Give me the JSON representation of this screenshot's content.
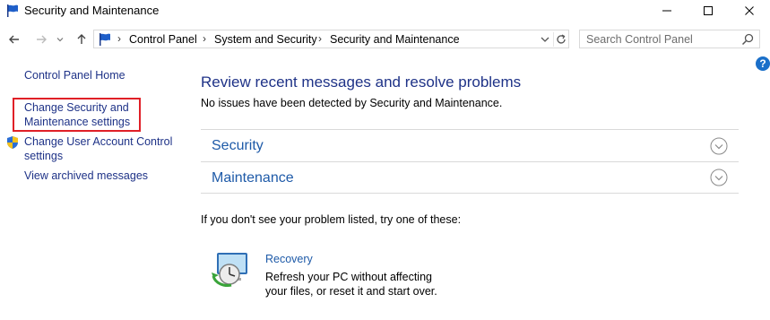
{
  "window": {
    "title": "Security and Maintenance"
  },
  "address": {
    "crumbs": [
      "Control Panel",
      "System and Security",
      "Security and Maintenance"
    ],
    "sep": "›"
  },
  "search": {
    "placeholder": "Search Control Panel"
  },
  "help": {
    "label": "?"
  },
  "sidebar": {
    "items": [
      {
        "label": "Control Panel Home"
      },
      {
        "label": "Change Security and Maintenance settings",
        "line1": "Change Security and",
        "line2": "Maintenance settings"
      },
      {
        "label": "Change User Account Control settings",
        "line1": "Change User Account Control",
        "line2": "settings"
      },
      {
        "label": "View archived messages"
      }
    ],
    "highlight_color": "#e02027"
  },
  "main": {
    "heading": "Review recent messages and resolve problems",
    "status": "No issues have been detected by Security and Maintenance.",
    "sections": [
      {
        "label": "Security"
      },
      {
        "label": "Maintenance"
      }
    ],
    "prompt": "If you don't see your problem listed, try one of these:",
    "recovery": {
      "link": "Recovery",
      "desc_line1": "Refresh your PC without affecting",
      "desc_line2": "your files, or reset it and start over."
    }
  },
  "colors": {
    "link": "#1e3287",
    "section_link": "#1e5aa8"
  }
}
